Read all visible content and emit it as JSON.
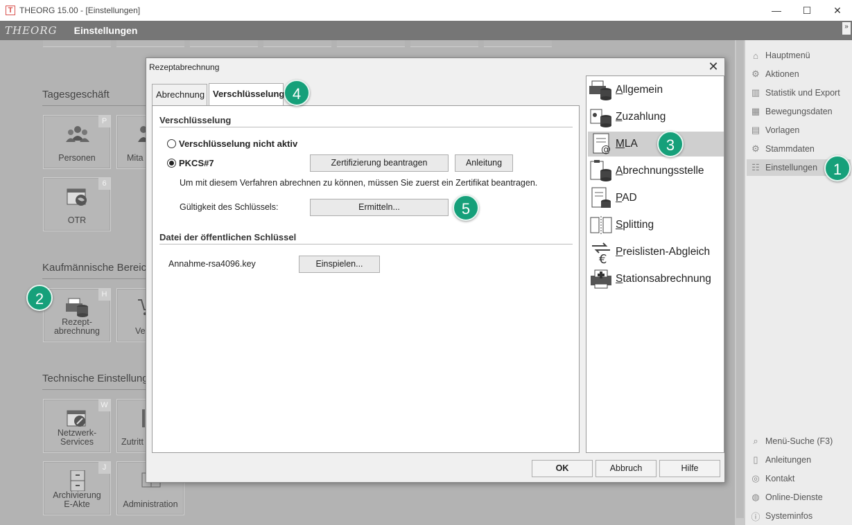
{
  "window": {
    "icon_letter": "T",
    "title": "THEORG 15.00 - [Einstellungen]",
    "minimize_glyph": "—",
    "maximize_glyph": "☐",
    "close_glyph": "✕"
  },
  "header": {
    "brand": "THEORG",
    "title": "Einstellungen",
    "expand_glyph": "»"
  },
  "main": {
    "sections": [
      {
        "heading": "Tagesgeschäft"
      },
      {
        "heading": "Kaufmännische Bereic"
      },
      {
        "heading": "Technische Einstellung"
      }
    ],
    "tiles": [
      {
        "label": "Personen",
        "hotkey": "P",
        "icon": "people-icon"
      },
      {
        "label": "Mita",
        "hotkey": "",
        "icon": "employee-icon"
      },
      {
        "label": "OTR",
        "hotkey": "6",
        "icon": "calendar-globe-icon"
      },
      {
        "label_line1": "Rezept-",
        "label_line2": "abrechnung",
        "hotkey": "H",
        "icon": "printer-database-icon"
      },
      {
        "label": "Ver",
        "hotkey": "",
        "icon": "cart-icon"
      },
      {
        "label_line1": "Netzwerk-",
        "label_line2": "Services",
        "hotkey": "W",
        "icon": "calendar-wrench-icon"
      },
      {
        "label": "Zutritt",
        "hotkey": "",
        "icon": "door-icon"
      },
      {
        "label_line1": "Archivierung",
        "label_line2": "E-Akte",
        "hotkey": "J",
        "icon": "cabinet-icon"
      },
      {
        "label": "Administration",
        "hotkey": "",
        "icon": "admin-icon"
      }
    ]
  },
  "right_nav": {
    "items": [
      {
        "label": "Hauptmenü",
        "icon": "home-icon"
      },
      {
        "label": "Aktionen",
        "icon": "gears-icon"
      },
      {
        "label": "Statistik und Export",
        "icon": "chart-icon"
      },
      {
        "label": "Bewegungsdaten",
        "icon": "grid-icon"
      },
      {
        "label": "Vorlagen",
        "icon": "document-icon"
      },
      {
        "label": "Stammdaten",
        "icon": "gear-icon"
      },
      {
        "label": "Einstellungen",
        "icon": "settings-icon"
      }
    ],
    "bottom_items": [
      {
        "label": "Menü-Suche (F3)",
        "icon": "search-icon"
      },
      {
        "label": "Anleitungen",
        "icon": "book-icon"
      },
      {
        "label": "Kontakt",
        "icon": "contact-icon"
      },
      {
        "label": "Online-Dienste",
        "icon": "globe-icon"
      },
      {
        "label": "Systeminfos",
        "icon": "info-icon"
      }
    ]
  },
  "dialog": {
    "title": "Rezeptabrechnung",
    "close_glyph": "✕",
    "tabs": [
      {
        "label": "Abrechnung"
      },
      {
        "label": "Verschlüsselung"
      }
    ],
    "encryption_group": {
      "title": "Verschlüsselung",
      "option_inactive": "Verschlüsselung nicht aktiv",
      "option_pkcs": "PKCS#7",
      "request_button": "Zertifizierung beantragen",
      "guide_button": "Anleitung",
      "info_text": "Um mit diesem Verfahren abrechnen zu können, müssen Sie zuerst ein Zertifikat beantragen.",
      "validity_label": "Gültigkeit des Schlüssels:",
      "determine_button": "Ermitteln..."
    },
    "key_file_group": {
      "title": "Datei der öffentlichen Schlüssel",
      "file_name": "Annahme-rsa4096.key",
      "import_button": "Einspielen..."
    },
    "side_items": [
      {
        "label": "Allgemein",
        "icon": "printer-database-icon"
      },
      {
        "label": "Zuzahlung",
        "icon": "coins-database-icon"
      },
      {
        "label": "MLA",
        "icon": "document-at-icon"
      },
      {
        "label": "Abrechnungsstelle",
        "icon": "clipboard-database-icon"
      },
      {
        "label": "PAD",
        "icon": "page-database-icon"
      },
      {
        "label": "Splitting",
        "icon": "split-icon"
      },
      {
        "label": "Preislisten-Abgleich",
        "icon": "euro-arrows-icon"
      },
      {
        "label": "Stationsabrechnung",
        "icon": "medical-printer-icon"
      }
    ],
    "footer": {
      "ok": "OK",
      "cancel": "Abbruch",
      "help": "Hilfe"
    }
  },
  "callouts": [
    "1",
    "2",
    "3",
    "4",
    "5"
  ],
  "colors": {
    "callout": "#16a07a",
    "header_bar": "#767676",
    "background": "#b3b3b3",
    "nav_active": "#d2d2d2"
  }
}
